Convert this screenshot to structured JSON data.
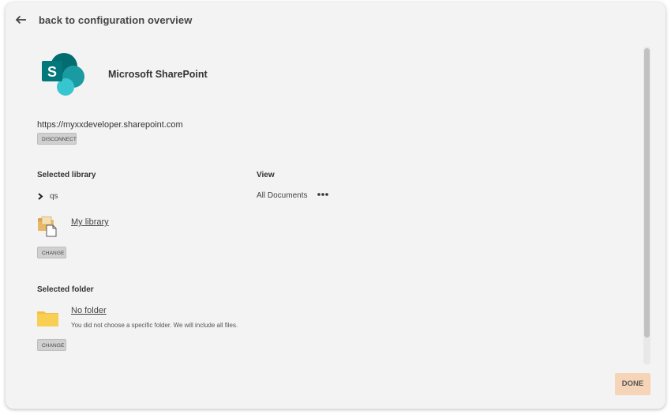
{
  "header": {
    "back_label": "back to configuration overview",
    "back_icon": "arrow-left-icon"
  },
  "connection": {
    "app_name": "Microsoft SharePoint",
    "logo_icon": "sharepoint-logo",
    "site_url": "https://myxxdeveloper.sharepoint.com",
    "disconnect_label": "DISCONNECT"
  },
  "library": {
    "title": "Selected library",
    "tree_item": "qs",
    "name": "My library",
    "change_label": "CHANGE",
    "icon": "library-icon"
  },
  "view": {
    "title": "View",
    "value": "All Documents",
    "more_icon": "more-horizontal-icon"
  },
  "folder": {
    "title": "Selected folder",
    "name": "No folder",
    "note": "You did not choose a specific folder. We will include all files.",
    "change_label": "CHANGE",
    "icon": "folder-icon"
  },
  "footer": {
    "done_label": "DONE"
  },
  "colors": {
    "card_background": "#f3f3f3",
    "done_button": "#f5d4b8",
    "folder_yellow": "#f7c948",
    "sharepoint_teal": "#038387"
  }
}
